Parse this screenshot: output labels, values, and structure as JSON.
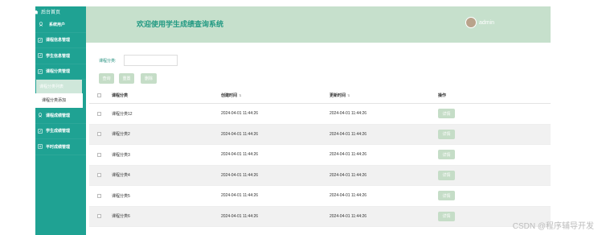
{
  "sidebar": {
    "home": "后台首页",
    "items": [
      {
        "label": "系统用户",
        "icon": "user-icon"
      },
      {
        "label": "课程信息管理",
        "icon": "edit-icon"
      },
      {
        "label": "学生信息管理",
        "icon": "edit-icon"
      },
      {
        "label": "课程分类管理",
        "icon": "edit-icon"
      },
      {
        "label": "课程分类列表"
      },
      {
        "label": "课程分类添加"
      },
      {
        "label": "课程成绩管理",
        "icon": "user-icon"
      },
      {
        "label": "学生成绩管理",
        "icon": "edit-icon"
      },
      {
        "label": "平时成绩管理",
        "icon": "plus-icon"
      }
    ]
  },
  "header": {
    "title": "欢迎使用学生成绩查询系统",
    "user": "admin"
  },
  "search": {
    "label": "课程分类:",
    "placeholder": ""
  },
  "buttons": {
    "query": "查询",
    "reset": "重置",
    "delete": "删除"
  },
  "table": {
    "columns": [
      "课程分类",
      "创建时间",
      "更新时间",
      "操作"
    ],
    "rows": [
      {
        "name": "课程分类12",
        "created": "2024-04-01 11:44:26",
        "updated": "2024-04-01 11:44:26",
        "action": "详情"
      },
      {
        "name": "课程分类2",
        "created": "2024-04-01 11:44:26",
        "updated": "2024-04-01 11:44:26",
        "action": "详情"
      },
      {
        "name": "课程分类3",
        "created": "2024-04-01 11:44:26",
        "updated": "2024-04-01 11:44:26",
        "action": "详情"
      },
      {
        "name": "课程分类4",
        "created": "2024-04-01 11:44:26",
        "updated": "2024-04-01 11:44:26",
        "action": "详情"
      },
      {
        "name": "课程分类5",
        "created": "2024-04-01 11:44:26",
        "updated": "2024-04-01 11:44:26",
        "action": "详情"
      },
      {
        "name": "课程分类6",
        "created": "2024-04-01 11:44:26",
        "updated": "2024-04-01 11:44:26",
        "action": "详情"
      }
    ]
  },
  "watermark": "CSDN @程序辅导开发",
  "colors": {
    "sidebar": "#1fa293",
    "header": "#c6e0cc",
    "button": "#c5ddc7",
    "title": "#239a83"
  }
}
